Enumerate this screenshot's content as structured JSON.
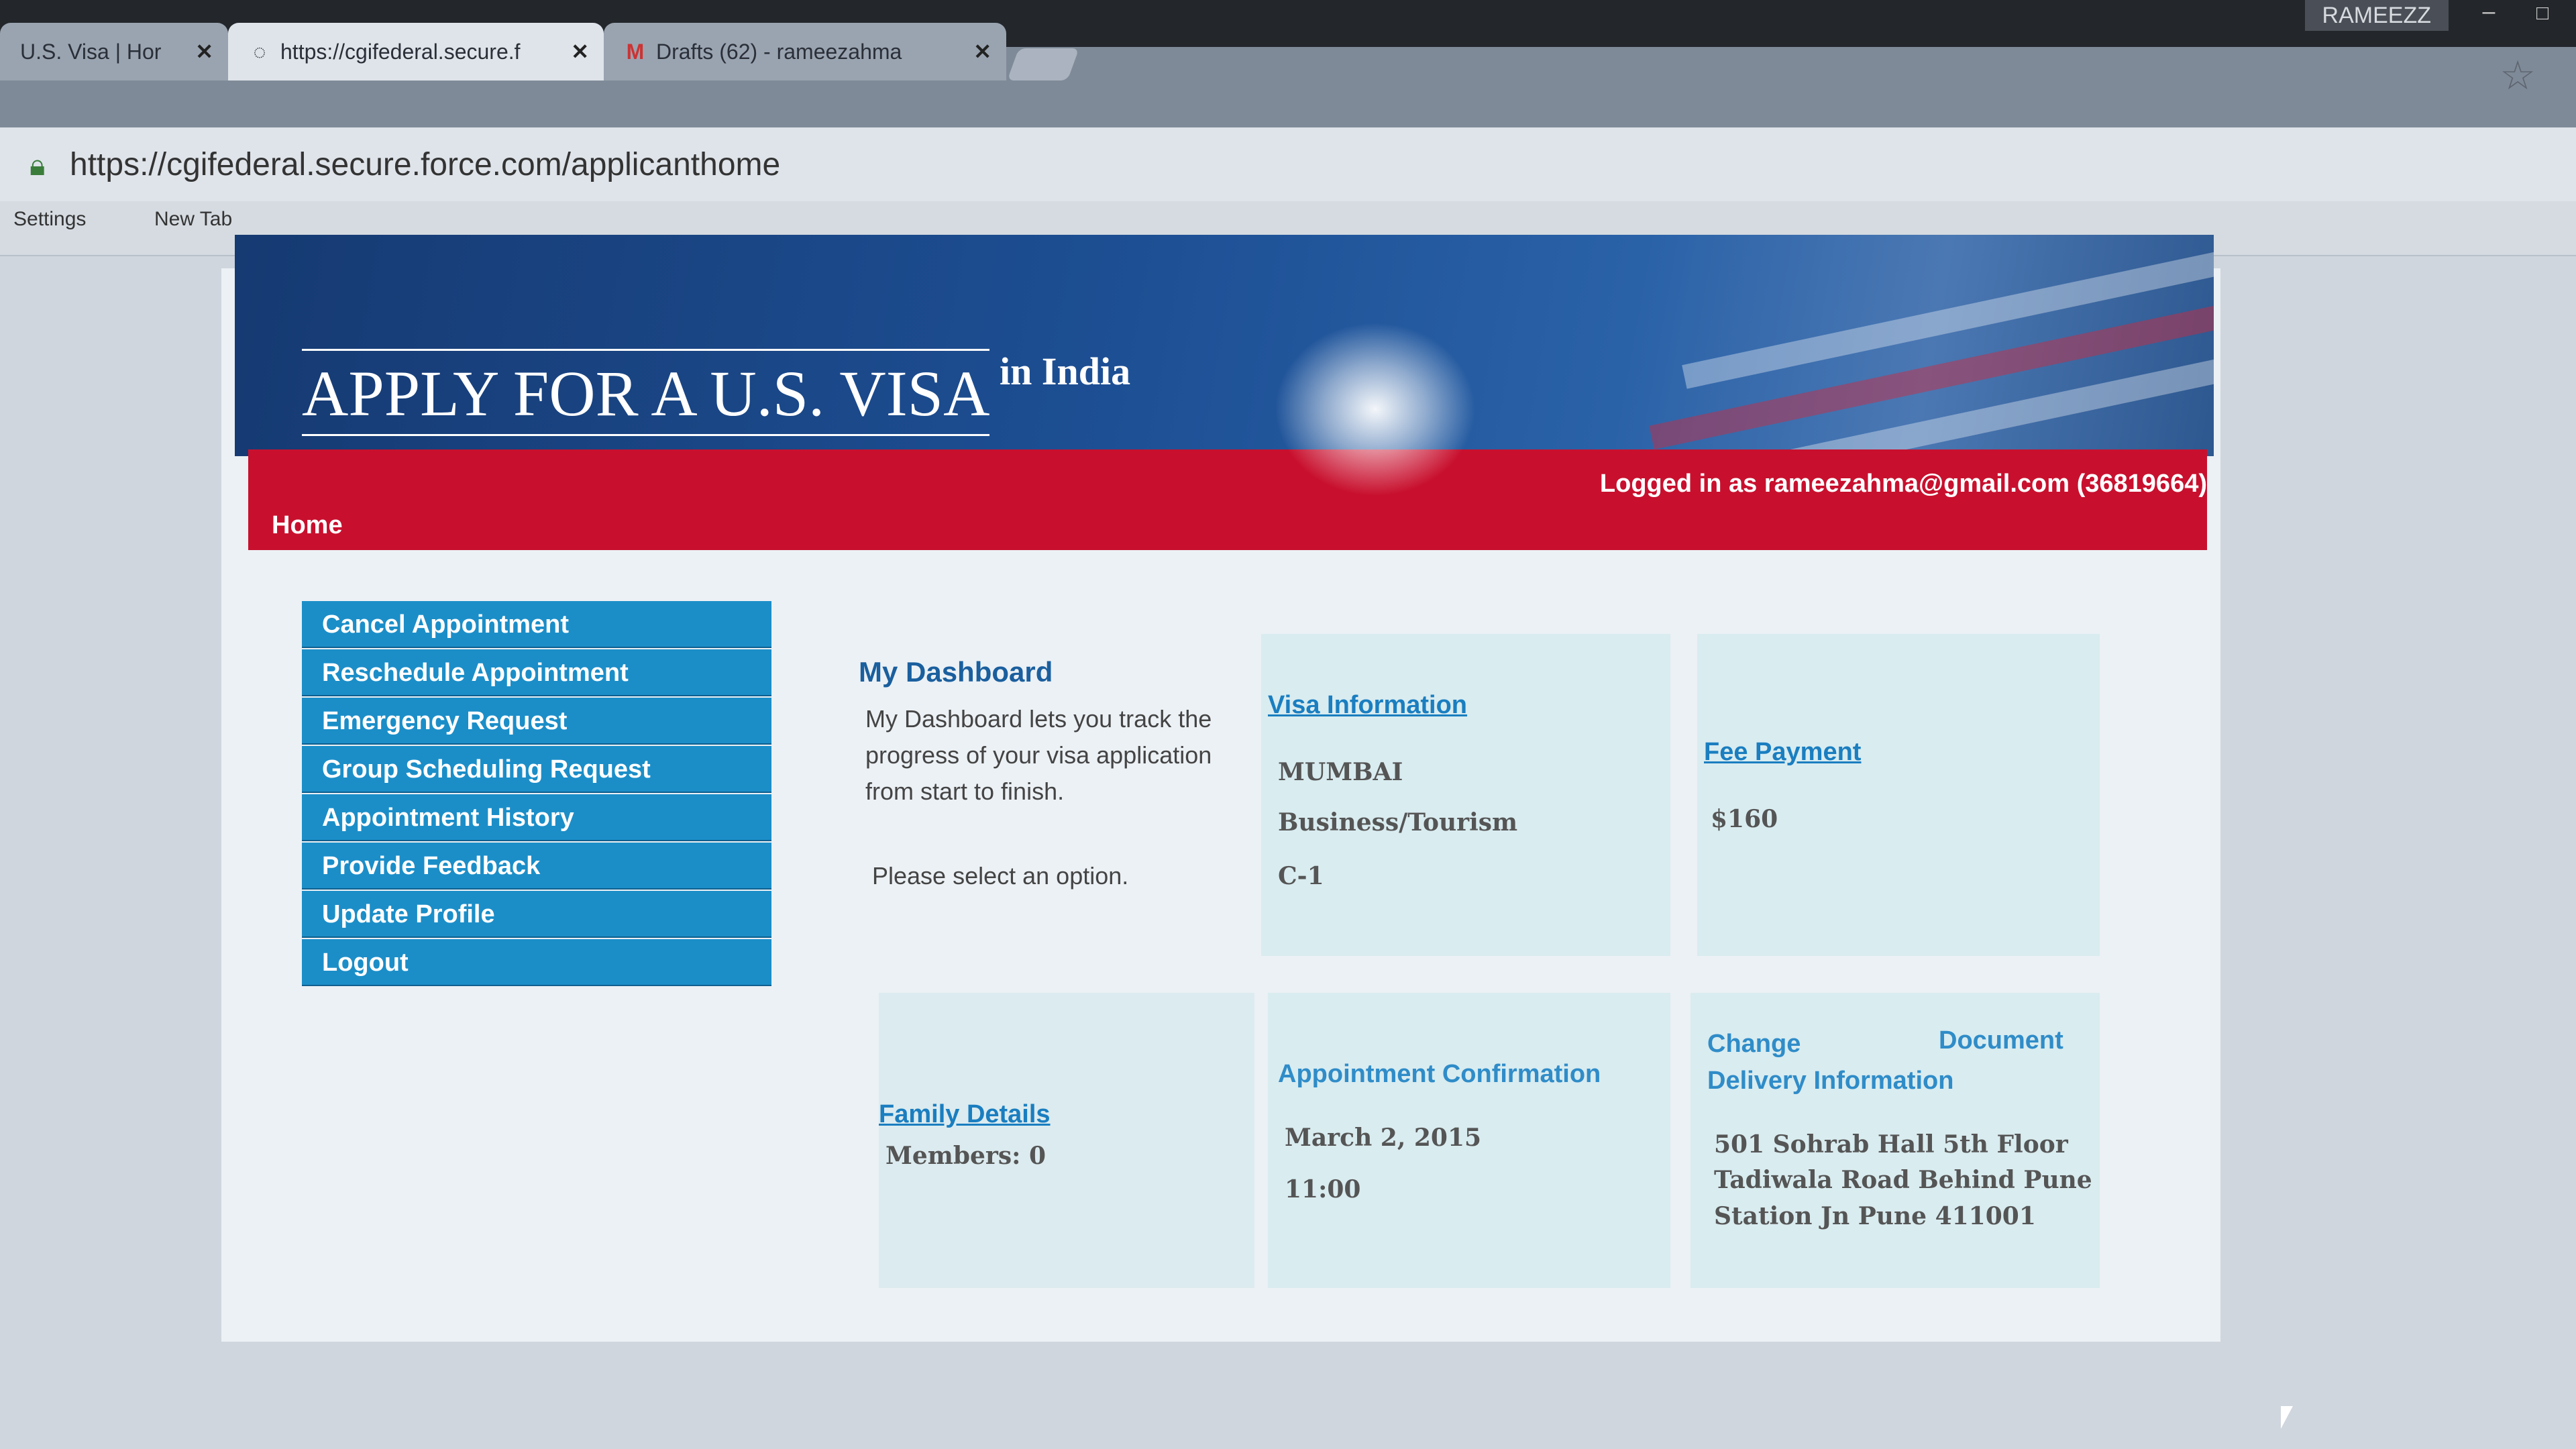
{
  "os": {
    "user": "RAMEEZZ"
  },
  "browser": {
    "tabs": [
      {
        "label": "U.S. Visa | Hor",
        "active": false
      },
      {
        "label": "https://cgifederal.secure.f",
        "active": true
      },
      {
        "label": "Drafts (62) - rameezahma",
        "active": false
      }
    ],
    "url": "https://cgifederal.secure.force.com/applicanthome",
    "bookmarks": [
      "Settings",
      "New Tab"
    ]
  },
  "header": {
    "title": "APPLY FOR A U.S. VISA",
    "subtitle": "in India",
    "nav_home": "Home",
    "logged_in": "Logged in as  rameezahma@gmail.com (36819664)"
  },
  "menu": [
    "Cancel Appointment",
    "Reschedule Appointment",
    "Emergency Request",
    "Group Scheduling Request",
    "Appointment History",
    "Provide Feedback",
    "Update Profile",
    "Logout"
  ],
  "dashboard": {
    "heading": "My Dashboard",
    "description": "My Dashboard lets you track the progress of your visa application from start to finish.",
    "prompt": "Please select an option."
  },
  "panels": {
    "visa": {
      "link": "Visa Information",
      "city": "MUMBAI",
      "type": "Business/Tourism",
      "class": "C-1"
    },
    "fee": {
      "link": "Fee Payment",
      "amount": "$160"
    },
    "family": {
      "link": "Family Details",
      "members": "Members: 0"
    },
    "appointment": {
      "heading": "Appointment Confirmation",
      "date": "March 2, 2015",
      "time": "11:00"
    },
    "delivery": {
      "heading_left": "Change",
      "heading_right": "Document",
      "heading_line2": "Delivery Information",
      "address": [
        "501 Sohrab Hall 5th Floor",
        "Tadiwala Road Behind Pune",
        "Station Jn Pune 411001"
      ]
    }
  },
  "colors": {
    "header_blue": "#1d4f94",
    "nav_red": "#c8102e",
    "menu_blue": "#1b8ec8",
    "panel_bg": "#d9ecf0"
  }
}
